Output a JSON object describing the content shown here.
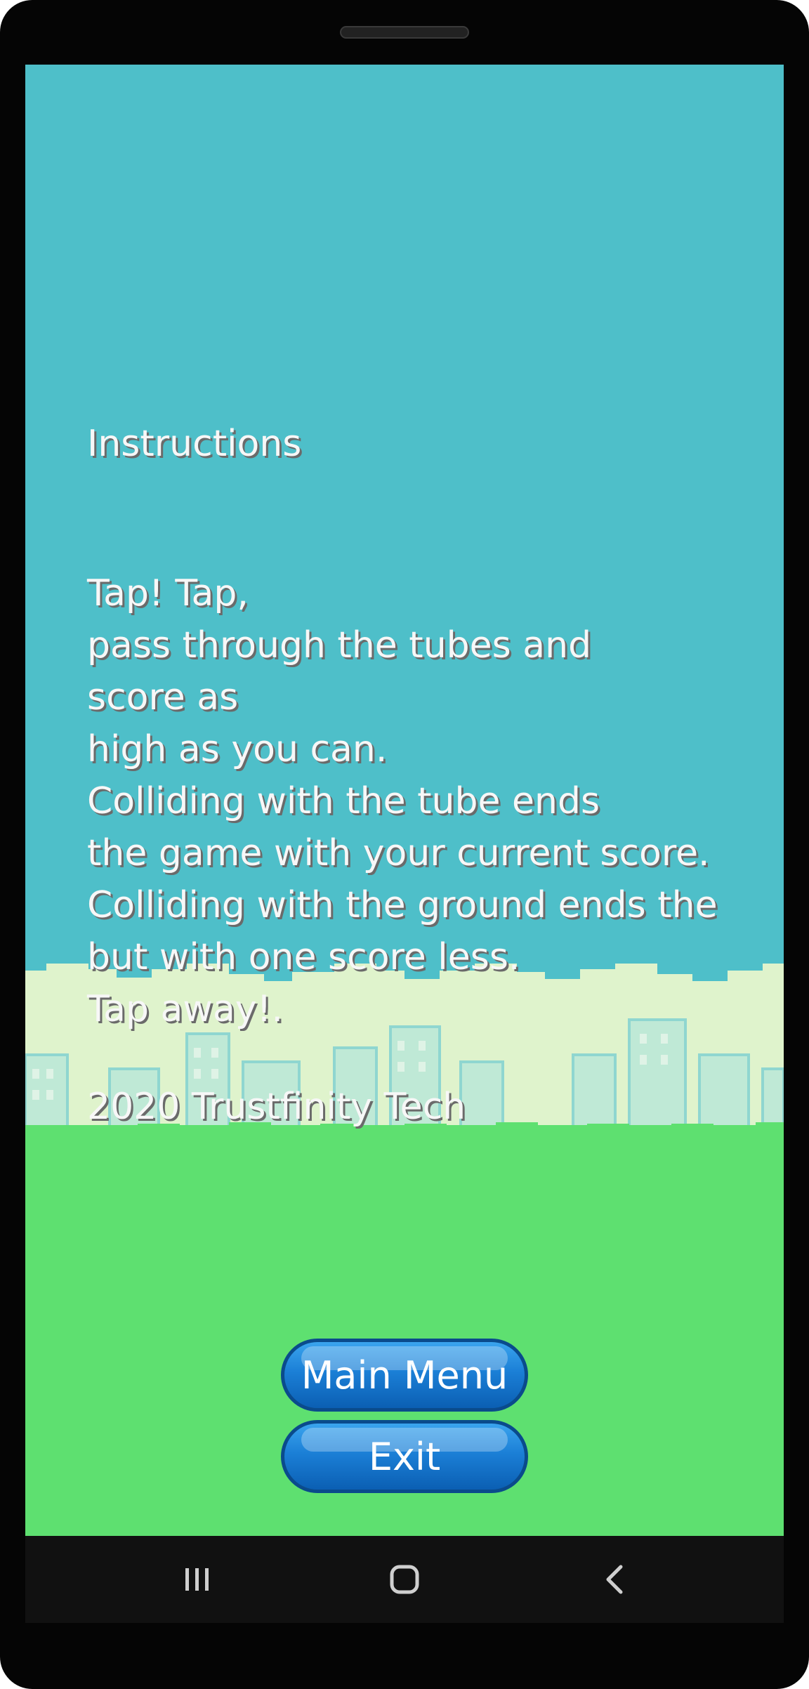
{
  "instructions": {
    "title": "Instructions",
    "lines": [
      "Tap! Tap,",
      "pass through the tubes and",
      "score as",
      "high as you can.",
      "Colliding with the tube ends",
      "the game with your current score.",
      "Colliding with the ground ends the",
      "but with one score less.",
      "Tap away!."
    ],
    "copyright": "2020 Trustfinity Tech"
  },
  "buttons": {
    "main_menu": "Main Menu",
    "exit": "Exit"
  },
  "navbar": {
    "recents_icon": "recents-icon",
    "home_icon": "home-icon",
    "back_icon": "back-icon"
  },
  "colors": {
    "sky": "#4ebfc9",
    "ground": "#5ee070",
    "button": "#1b7fd6"
  }
}
